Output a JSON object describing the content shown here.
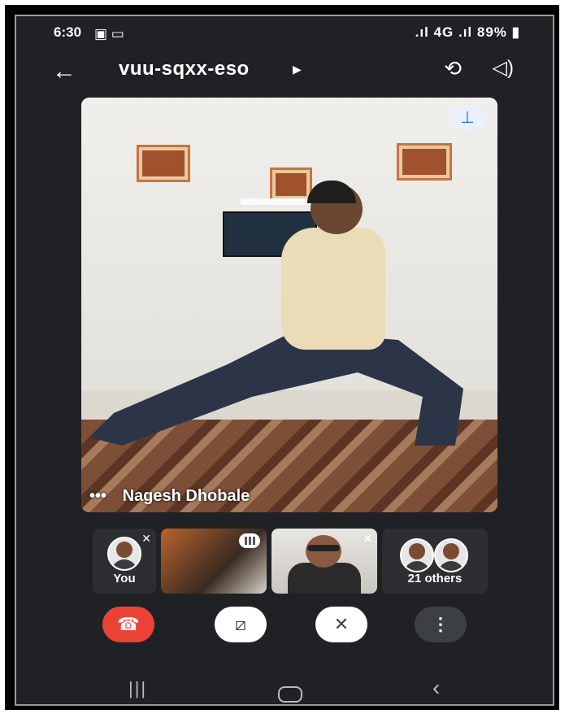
{
  "status_bar": {
    "time": "6:30",
    "left_icons": [
      "gallery-icon",
      "video-record-icon"
    ],
    "signal_text": "4G",
    "battery": "89%"
  },
  "toolbar": {
    "meeting_code": "vuu-sqxx-eso",
    "back_icon": "back-arrow-icon",
    "flip_icon": "switch-camera-icon",
    "audio_icon": "speaker-icon"
  },
  "main_video": {
    "participant_name": "Nagesh Dhobale",
    "pin_icon": "pin-icon",
    "more_dots": "•••"
  },
  "thumbnails": {
    "you_label": "You",
    "others_label": "21 others"
  },
  "controls": {
    "end_call_icon": "end-call-icon",
    "camera_icon": "camera-off-icon",
    "mic_icon": "mic-off-icon",
    "more_icon": "more-vertical-icon"
  },
  "navigation": {
    "recent_icon": "recent-apps-icon",
    "home_icon": "home-icon",
    "back_icon": "nav-back-icon"
  },
  "colors": {
    "background": "#202124",
    "end_call": "#ea4335",
    "pin_accent": "#1a73e8"
  }
}
